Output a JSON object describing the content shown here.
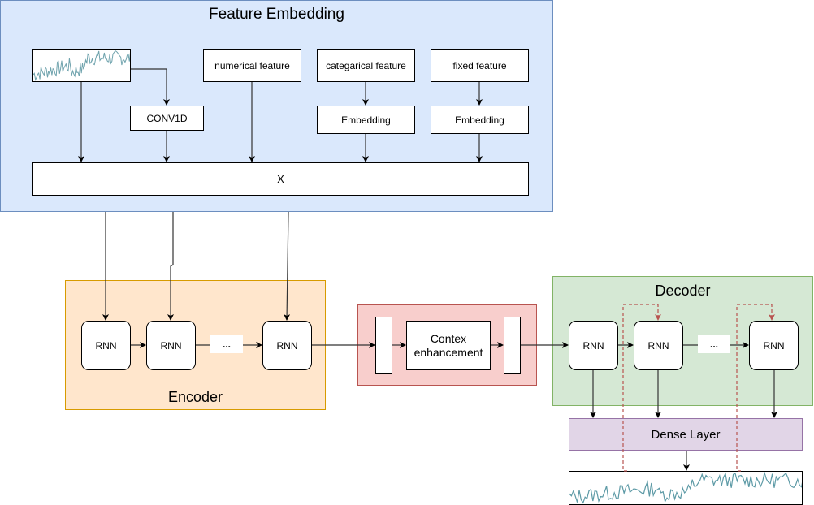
{
  "feature_embedding": {
    "title": "Feature Embedding",
    "numerical_feature": "numerical feature",
    "categorical_feature": "categarical feature",
    "fixed_feature": "fixed feature",
    "conv1d": "CONV1D",
    "embedding_1": "Embedding",
    "embedding_2": "Embedding",
    "x_label": "X"
  },
  "encoder": {
    "title": "Encoder",
    "rnn_1": "RNN",
    "rnn_2": "RNN",
    "ellipsis": "...",
    "rnn_3": "RNN"
  },
  "context": {
    "label": "Contex enhancement"
  },
  "decoder": {
    "title": "Decoder",
    "rnn_1": "RNN",
    "rnn_2": "RNN",
    "ellipsis": "...",
    "rnn_3": "RNN"
  },
  "dense": {
    "label": "Dense Layer"
  },
  "colors": {
    "feature_bg": "#dae8fc",
    "encoder_bg": "#ffe6cc",
    "context_bg": "#f8cecc",
    "decoder_bg": "#d5e8d4",
    "dense_bg": "#e1d5e7",
    "series_line": "#5d9aa6",
    "feedback_dash": "#b85450"
  }
}
